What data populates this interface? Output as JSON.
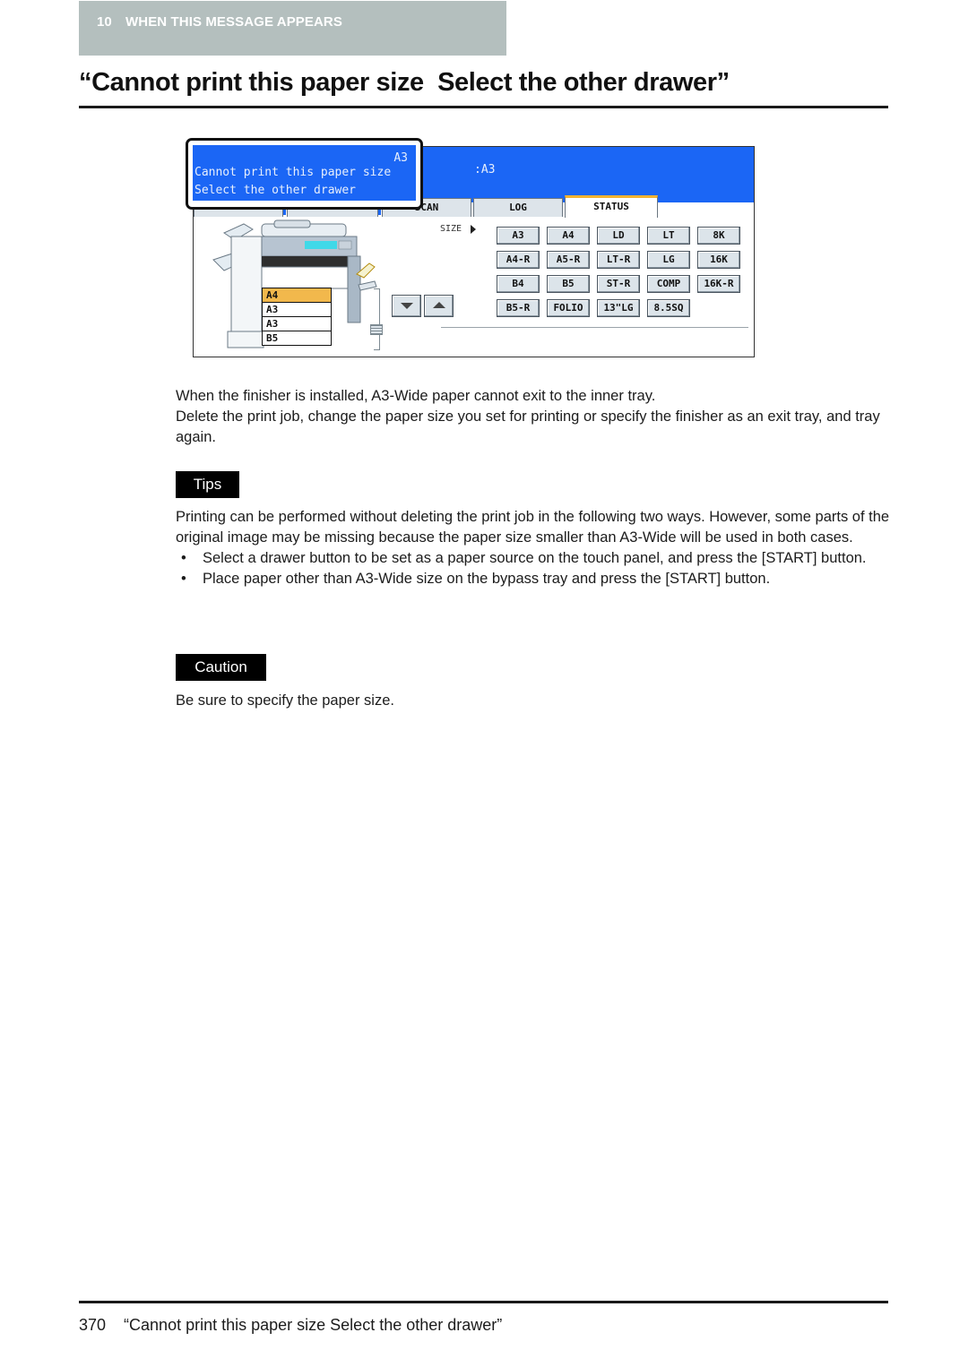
{
  "header": {
    "chapter_number": "10",
    "chapter_title": "WHEN THIS MESSAGE APPEARS"
  },
  "page_title": "“Cannot print this paper size  Select the other drawer”",
  "panel": {
    "message": {
      "paper_code": "A3",
      "line1": "Cannot print this paper size",
      "line2": "Select the other drawer"
    },
    "size_readout": ":A3",
    "tabs": [
      {
        "label": "SCAN",
        "active": false
      },
      {
        "label": "LOG",
        "active": false
      },
      {
        "label": "STATUS",
        "active": true
      }
    ],
    "size_label": "SIZE",
    "size_buttons": [
      [
        "A3",
        "A4",
        "LD",
        "LT",
        "8K"
      ],
      [
        "A4-R",
        "A5-R",
        "LT-R",
        "LG",
        "16K"
      ],
      [
        "B4",
        "B5",
        "ST-R",
        "COMP",
        "16K-R"
      ],
      [
        "B5-R",
        "FOLIO",
        "13\"LG",
        "8.5SQ"
      ]
    ],
    "drawers": [
      {
        "label": "A4",
        "selected": true
      },
      {
        "label": "A3",
        "selected": false
      },
      {
        "label": "A3",
        "selected": false
      },
      {
        "label": "B5",
        "selected": false
      }
    ],
    "colors": {
      "screen_blue": "#1b66f5",
      "selected_drawer": "#f2b84c",
      "active_tab_accent": "#f2b231"
    }
  },
  "description": {
    "line1": "When the finisher is installed, A3-Wide paper cannot exit to the inner tray.",
    "line2": "Delete the print job, change the paper size you set for printing or specify the finisher as an exit tray, and tray again."
  },
  "tips": {
    "label": "Tips",
    "intro": "Printing can be performed without deleting the print job in the following two ways. However, some parts of the original image may be missing because the paper size smaller than A3-Wide will be used in both cases.",
    "bullets": [
      "Select a drawer button to be set as a paper source on the touch panel, and press the [START] button.",
      "Place paper other than A3-Wide size on the bypass tray and press the [START] button."
    ],
    "bullet_glyph": "•"
  },
  "caution": {
    "label": "Caution",
    "text": "Be sure to specify the paper size."
  },
  "footer": {
    "page_number": "370",
    "title": "“Cannot print this paper size Select the other drawer”"
  }
}
